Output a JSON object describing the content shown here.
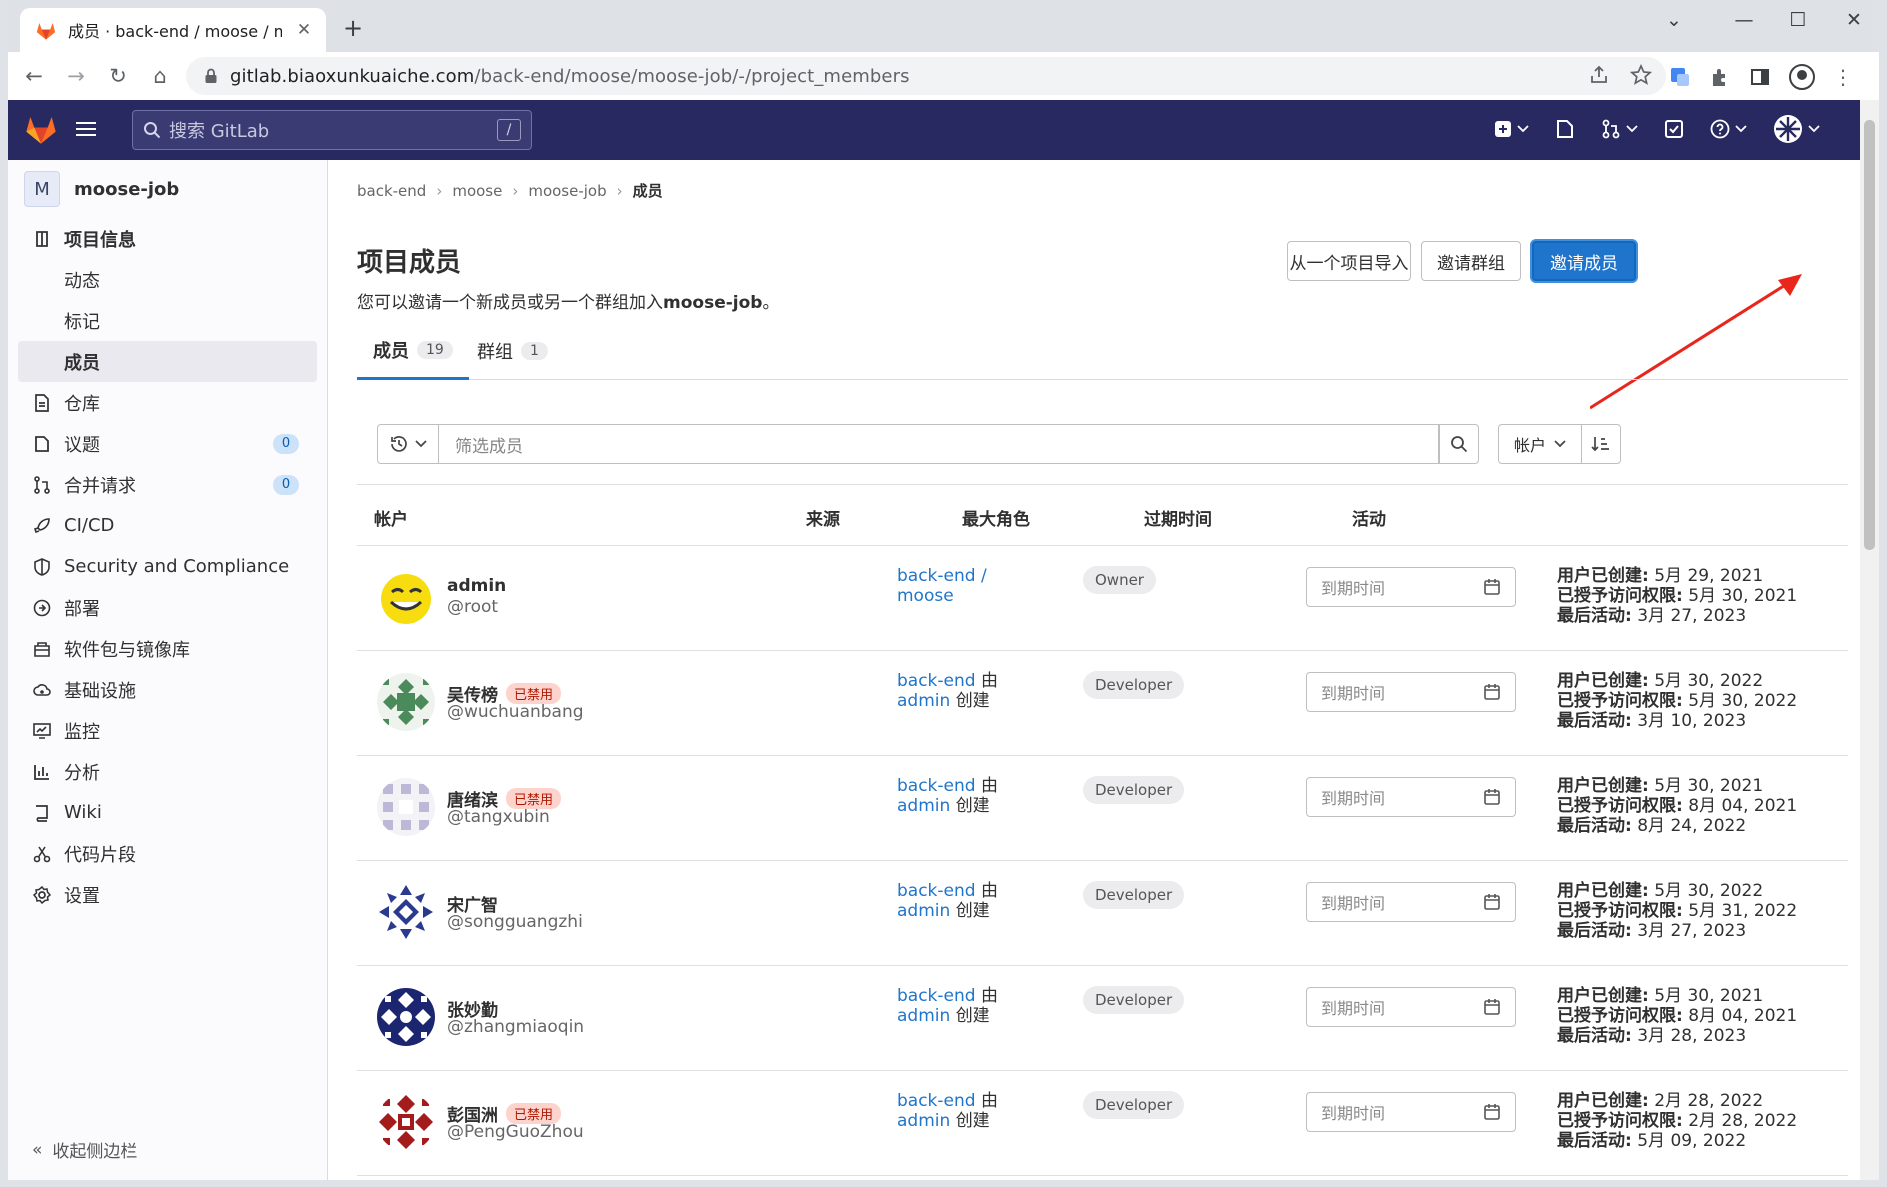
{
  "browser": {
    "tab_title": "成员 · back-end / moose / mo",
    "url_host": "gitlab.biaoxunkuaiche.com",
    "url_path": "/back-end/moose/moose-job/-/project_members"
  },
  "gitlab_nav": {
    "search_placeholder": "搜索 GitLab",
    "search_shortcut": "/"
  },
  "sidebar": {
    "project_initial": "M",
    "project_name": "moose-job",
    "items": [
      {
        "label": "项目信息",
        "icon": "info-icon"
      },
      {
        "label": "动态"
      },
      {
        "label": "标记"
      },
      {
        "label": "成员"
      },
      {
        "label": "仓库",
        "icon": "document-icon"
      },
      {
        "label": "议题",
        "icon": "issues-icon",
        "count": "0"
      },
      {
        "label": "合并请求",
        "icon": "merge-request-icon",
        "count": "0"
      },
      {
        "label": "CI/CD",
        "icon": "rocket-icon"
      },
      {
        "label": "Security and Compliance",
        "icon": "shield-icon"
      },
      {
        "label": "部署",
        "icon": "deployments-icon"
      },
      {
        "label": "软件包与镜像库",
        "icon": "package-icon"
      },
      {
        "label": "基础设施",
        "icon": "cloud-gear-icon"
      },
      {
        "label": "监控",
        "icon": "monitor-icon"
      },
      {
        "label": "分析",
        "icon": "chart-icon"
      },
      {
        "label": "Wiki",
        "icon": "book-icon"
      },
      {
        "label": "代码片段",
        "icon": "snippet-icon"
      },
      {
        "label": "设置",
        "icon": "settings-icon"
      }
    ],
    "collapse_label": "收起侧边栏"
  },
  "breadcrumb": [
    "back-end",
    "moose",
    "moose-job",
    "成员"
  ],
  "page": {
    "title": "项目成员",
    "desc_prefix": "您可以邀请一个新成员或另一个群组加入",
    "desc_project": "moose-job",
    "desc_suffix": "。",
    "btn_import": "从一个项目导入",
    "btn_invite_group": "邀请群组",
    "btn_invite_member": "邀请成员"
  },
  "tabs": [
    {
      "label": "成员",
      "count": "19"
    },
    {
      "label": "群组",
      "count": "1"
    }
  ],
  "filter": {
    "placeholder": "筛选成员",
    "sort_label": "帐户"
  },
  "table": {
    "headers": [
      "帐户",
      "来源",
      "最大角色",
      "过期时间",
      "活动"
    ],
    "expire_placeholder": "到期时间",
    "label_created": "用户已创建:",
    "label_access": "已授予访问权限:",
    "label_last": "最后活动:",
    "disabled_label": "已禁用",
    "rows": [
      {
        "name": "admin",
        "handle": "@root",
        "disabled": false,
        "source_line1": "back-end /",
        "source_line2": "moose",
        "source_by": "",
        "role": "Owner",
        "created": "5月 29, 2021",
        "access": "5月 30, 2021",
        "last": "3月 27, 2023",
        "avatar": "smiley"
      },
      {
        "name": "吴传榜",
        "handle": "@wuchuanbang",
        "disabled": true,
        "source_line1": "back-end",
        "source_line2": "admin",
        "source_by": "由",
        "source_created": "创建",
        "role": "Developer",
        "created": "5月 30, 2022",
        "access": "5月 30, 2022",
        "last": "3月 10, 2023",
        "avatar": "green"
      },
      {
        "name": "唐绪滨",
        "handle": "@tangxubin",
        "disabled": true,
        "source_line1": "back-end",
        "source_line2": "admin",
        "source_by": "由",
        "source_created": "创建",
        "role": "Developer",
        "created": "5月 30, 2021",
        "access": "8月 04, 2021",
        "last": "8月 24, 2022",
        "avatar": "lavender"
      },
      {
        "name": "宋广智",
        "handle": "@songguangzhi",
        "disabled": false,
        "source_line1": "back-end",
        "source_line2": "admin",
        "source_by": "由",
        "source_created": "创建",
        "role": "Developer",
        "created": "5月 30, 2022",
        "access": "5月 31, 2022",
        "last": "3月 27, 2023",
        "avatar": "blue-tri"
      },
      {
        "name": "张妙勤",
        "handle": "@zhangmiaoqin",
        "disabled": false,
        "source_line1": "back-end",
        "source_line2": "admin",
        "source_by": "由",
        "source_created": "创建",
        "role": "Developer",
        "created": "5月 30, 2021",
        "access": "8月 04, 2021",
        "last": "3月 28, 2023",
        "avatar": "navy"
      },
      {
        "name": "彭国洲",
        "handle": "@PengGuoZhou",
        "disabled": true,
        "source_line1": "back-end",
        "source_line2": "admin",
        "source_by": "由",
        "source_created": "创建",
        "role": "Developer",
        "created": "2月 28, 2022",
        "access": "2月 28, 2022",
        "last": "5月 09, 2022",
        "avatar": "red"
      }
    ]
  },
  "colors": {
    "nav_bg": "#292961",
    "primary": "#1f75cb",
    "annotation_arrow": "#e8261b",
    "disabled_badge_bg": "#fdd4cd"
  }
}
